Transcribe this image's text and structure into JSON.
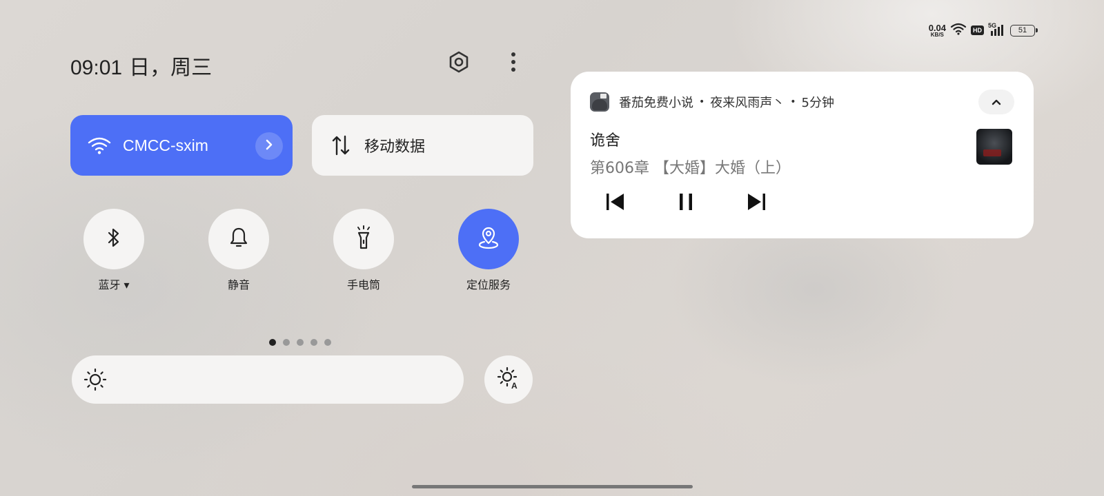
{
  "status_bar": {
    "net_speed_value": "0.04",
    "net_speed_unit": "KB/S",
    "hd_badge": "HD",
    "network_type": "5G",
    "battery_level": "51",
    "icons": [
      "wifi-icon",
      "signal-icon",
      "battery-icon"
    ]
  },
  "header": {
    "time": "09:01",
    "date": "日，周三",
    "settings_icon": "hexagon-settings-icon",
    "more_icon": "more-vertical-icon"
  },
  "tiles": {
    "wifi": {
      "label": "CMCC-sxim",
      "active": true
    },
    "mobile_data": {
      "label": "移动数据",
      "active": false
    }
  },
  "toggles": [
    {
      "label": "蓝牙 ▾",
      "icon": "bluetooth-icon",
      "active": false
    },
    {
      "label": "静音",
      "icon": "bell-icon",
      "active": false
    },
    {
      "label": "手电筒",
      "icon": "flashlight-icon",
      "active": false
    },
    {
      "label": "定位服务",
      "icon": "location-pin-icon",
      "active": true
    }
  ],
  "pager": {
    "count": 5,
    "current": 1
  },
  "brightness": {
    "icon": "sun-icon",
    "auto_icon": "auto-brightness-icon"
  },
  "media": {
    "app_name": "番茄免费小说",
    "author": "夜来风雨声丶",
    "time_ago": "5分钟",
    "title": "诡舍",
    "subtitle": "第606章 【大婚】大婚（上）",
    "controls": [
      "previous-icon",
      "pause-icon",
      "next-icon"
    ]
  },
  "colors": {
    "accent": "#4d6ff6",
    "tile_bg": "#f5f4f3",
    "card_bg": "#ffffff",
    "text_primary": "#222222",
    "text_secondary": "#777777"
  }
}
